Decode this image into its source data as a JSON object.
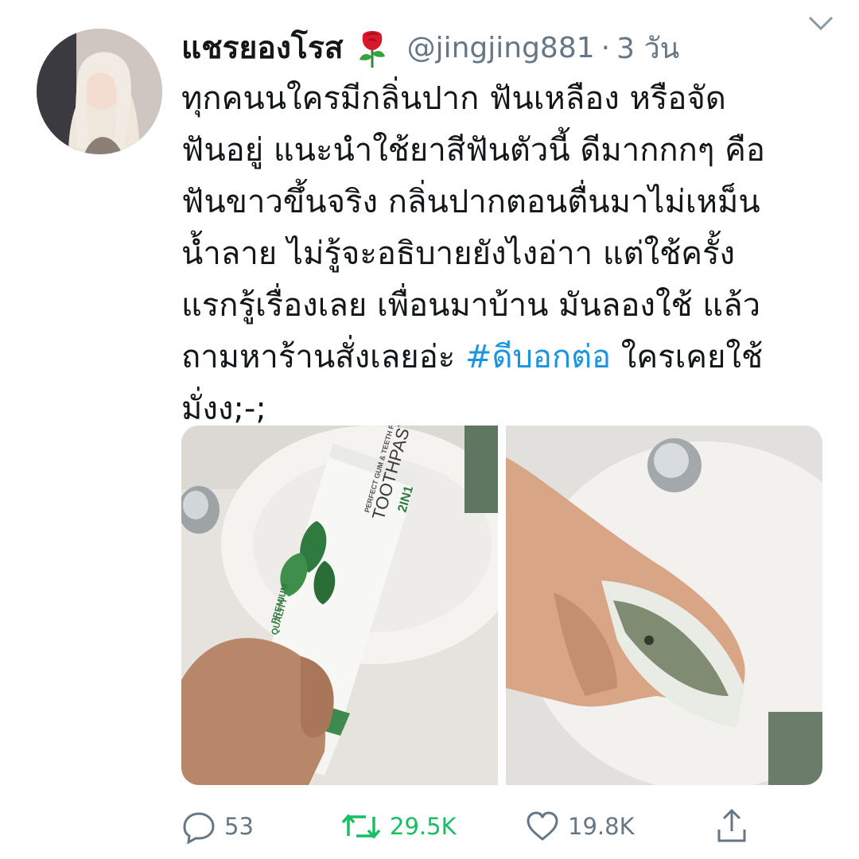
{
  "tweet": {
    "display_name": "แชรยองโรส",
    "handle": "@jingjing881",
    "separator": "·",
    "time": "3 วัน",
    "icons": [
      "rose-icon",
      "chevron-down-icon"
    ],
    "text_lines": [
      "ทุกคนนใครมีกลิ่นปาก ฟันเหลือง หรือจัด",
      "ฟันอยู่ แนะนำใช้ยาสีฟันตัวนี้ ดีมากกกๆ คือ",
      "ฟันขาวขึ้นจริง กลิ่นปากตอนตื่นมาไม่เหม็น",
      "น้ำลาย ไม่รู้จะอธิบายยังไงอ่าา แต่ใช้ครั้ง",
      "แรกรู้เรื่องเลย เพื่อนมาบ้าน มันลองใช้ แล้ว"
    ],
    "line6_before": "ถามหาร้านสั่งเลยอ่ะ ",
    "hashtag": "#ดีบอกต่อ",
    "line6_after": " ใครเคยใช้",
    "line7": "มั่งง;-;",
    "hashtag_color": "#1b95e0"
  },
  "photos": {
    "left": {
      "tube_text": [
        "2IN1",
        "PERFECT GUM & TEETH PROTECTION",
        "TOOTHPASTE",
        "PREMIUM",
        "QUALITY"
      ]
    }
  },
  "actions": {
    "reply_count": "53",
    "retweet_count": "29.5K",
    "like_count": "19.8K",
    "retweet_color": "#17bf63",
    "muted_color": "#657786"
  }
}
